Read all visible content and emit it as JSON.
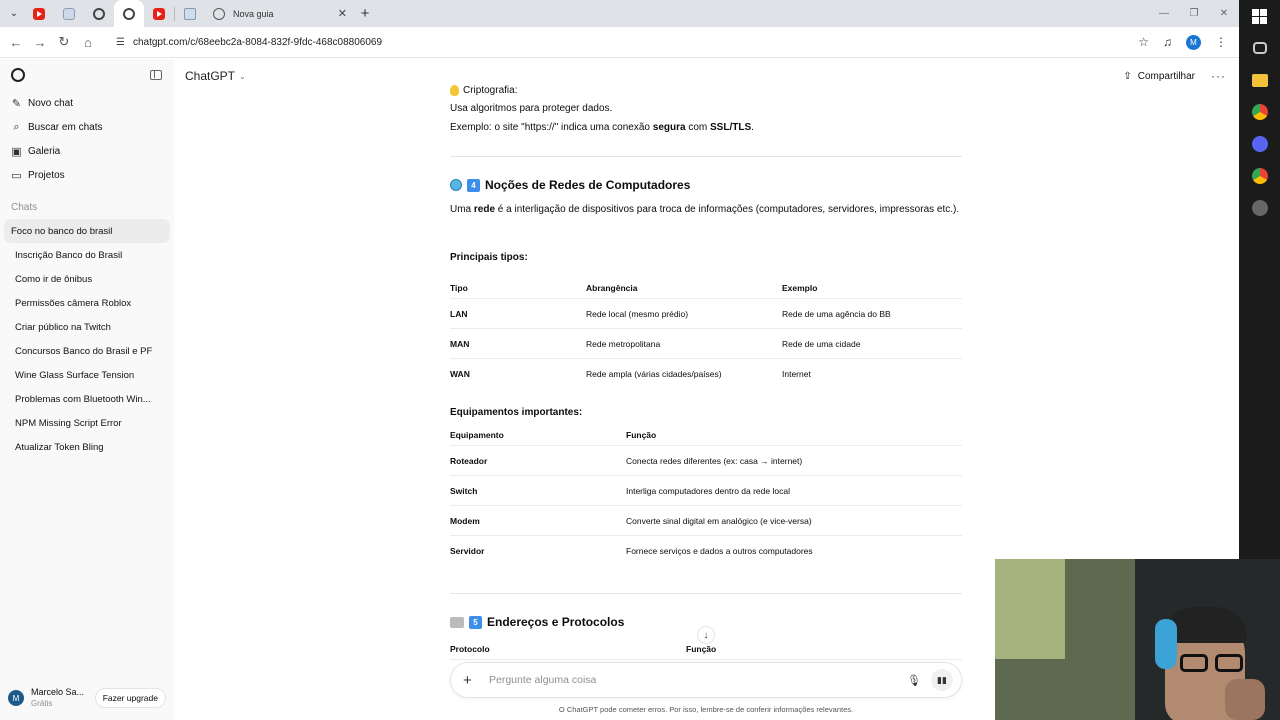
{
  "browser": {
    "new_tab_title": "Nova guia",
    "new_tab_plus": "+",
    "url": "chatgpt.com/c/68eebc2a-8084-832f-9fdc-468c08806069",
    "profile_initial": "M",
    "window_controls": [
      "—",
      "❐",
      "✕"
    ]
  },
  "sidebar": {
    "actions": [
      {
        "icon": "new-chat-icon",
        "label": "Novo chat"
      },
      {
        "icon": "search-icon",
        "label": "Buscar em chats"
      },
      {
        "icon": "gallery-icon",
        "label": "Galeria"
      },
      {
        "icon": "projects-icon",
        "label": "Projetos"
      }
    ],
    "chats_header": "Chats",
    "chats": [
      "Foco no banco do brasil",
      "Inscrição Banco do Brasil",
      "Como ir de ônibus",
      "Permissões câmera Roblox",
      "Criar público na Twitch",
      "Concursos Banco do Brasil e PF",
      "Wine Glass Surface Tension",
      "Problemas com Bluetooth Win...",
      "NPM Missing Script Error",
      "Atualizar Token Bling"
    ],
    "user_name": "Marcelo Sa...",
    "user_initial": "M",
    "user_plan": "Grátis",
    "upgrade_label": "Fazer upgrade"
  },
  "header": {
    "model": "ChatGPT",
    "share_label": "Compartilhar",
    "more_label": "···"
  },
  "content": {
    "crypto_title": "Criptografia:",
    "crypto_line1": "Usa algoritmos para proteger dados.",
    "crypto_line2_a": "Exemplo: o site \"https://\" indica uma conexão ",
    "crypto_line2_bold1": "segura",
    "crypto_line2_b": " com ",
    "crypto_line2_bold2": "SSL/TLS",
    "crypto_line2_c": ".",
    "section4_num": "4",
    "section4_title": "Noções de Redes de Computadores",
    "section4_para_a": "Uma ",
    "section4_para_bold": "rede",
    "section4_para_b": " é a interligação de dispositivos para troca de informações (computadores, servidores, impressoras etc.).",
    "types_heading": "Principais tipos:",
    "types_table": {
      "headers": [
        "Tipo",
        "Abrangência",
        "Exemplo"
      ],
      "rows": [
        [
          "LAN",
          "Rede local (mesmo prédio)",
          "Rede de uma agência do BB"
        ],
        [
          "MAN",
          "Rede metropolitana",
          "Rede de uma cidade"
        ],
        [
          "WAN",
          "Rede ampla (várias cidades/países)",
          "Internet"
        ]
      ]
    },
    "equip_heading": "Equipamentos importantes:",
    "equip_table": {
      "headers": [
        "Equipamento",
        "Função"
      ],
      "rows": [
        [
          "Roteador",
          "Conecta redes diferentes (ex: casa → internet)"
        ],
        [
          "Switch",
          "Interliga computadores dentro da rede local"
        ],
        [
          "Modem",
          "Converte sinal digital em analógico (e vice-versa)"
        ],
        [
          "Servidor",
          "Fornece serviços e dados a outros computadores"
        ]
      ]
    },
    "section5_num": "5",
    "section5_title": "Endereços e Protocolos",
    "proto_headers": [
      "Protocolo",
      "Função"
    ]
  },
  "composer": {
    "placeholder": "Pergunte alguma coisa",
    "disclaimer": "O ChatGPT pode cometer erros. Por isso, lembre-se de conferir informações relevantes."
  },
  "colors": {
    "accent_blue": "#3d8ee8",
    "sidebar_bg": "#f9f9f9",
    "tabbar_bg": "#dfe3e8",
    "taskbar_bg": "#1b1b1b"
  }
}
